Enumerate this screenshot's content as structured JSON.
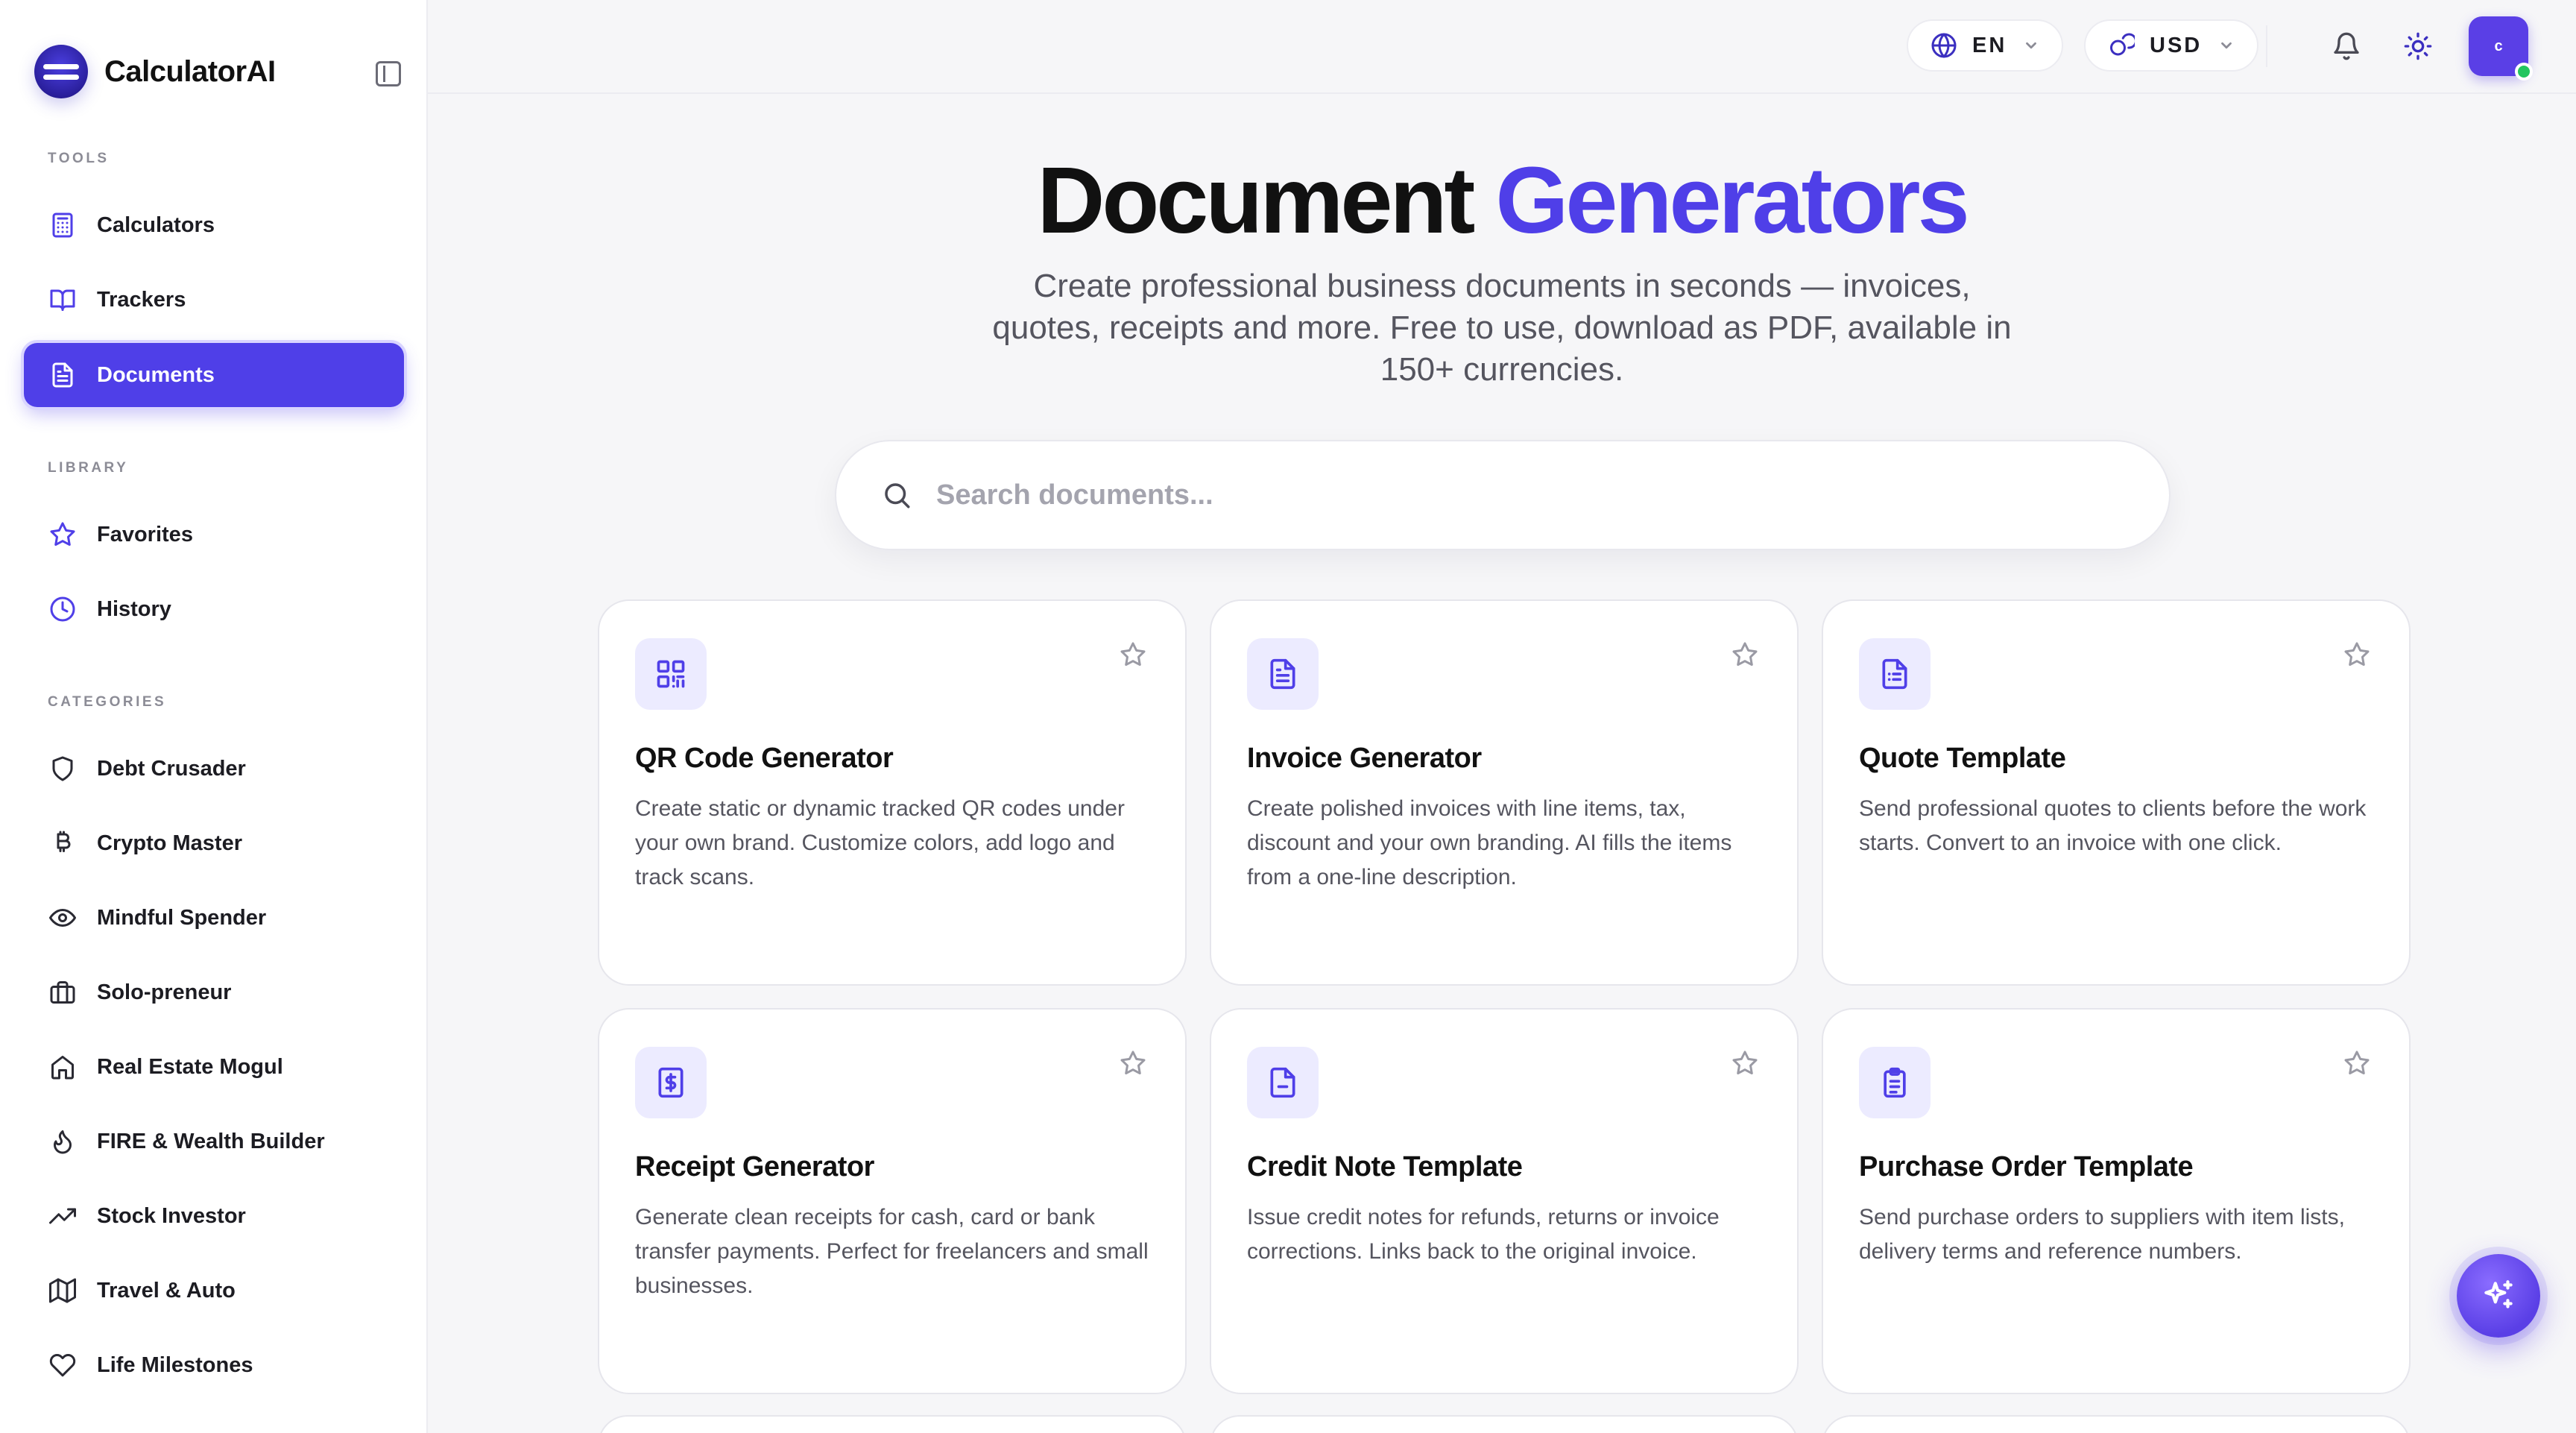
{
  "brand": {
    "name": "CalculatorAI"
  },
  "sidebar": {
    "tools_label": "TOOLS",
    "tools": [
      {
        "label": "Calculators",
        "icon": "calculator-icon"
      },
      {
        "label": "Trackers",
        "icon": "book-open-icon"
      },
      {
        "label": "Documents",
        "icon": "document-icon",
        "active": true
      }
    ],
    "library_label": "LIBRARY",
    "library": [
      {
        "label": "Favorites",
        "icon": "star-icon"
      },
      {
        "label": "History",
        "icon": "clock-icon"
      }
    ],
    "categories_label": "CATEGORIES",
    "categories": [
      {
        "label": "Debt Crusader",
        "icon": "shield-icon"
      },
      {
        "label": "Crypto Master",
        "icon": "bitcoin-icon"
      },
      {
        "label": "Mindful Spender",
        "icon": "eye-icon"
      },
      {
        "label": "Solo-preneur",
        "icon": "briefcase-icon"
      },
      {
        "label": "Real Estate Mogul",
        "icon": "home-icon"
      },
      {
        "label": "FIRE & Wealth Builder",
        "icon": "flame-icon"
      },
      {
        "label": "Stock Investor",
        "icon": "trending-up-icon"
      },
      {
        "label": "Travel & Auto",
        "icon": "map-icon"
      },
      {
        "label": "Life Milestones",
        "icon": "heart-icon"
      }
    ]
  },
  "topbar": {
    "language": "EN",
    "currency": "USD",
    "avatar_initial": "c"
  },
  "hero": {
    "title_main": "Document",
    "title_accent": "Generators",
    "subtitle": "Create professional business documents in seconds — invoices, quotes, receipts and more. Free to use, download as PDF, available in 150+ currencies."
  },
  "search": {
    "placeholder": "Search documents..."
  },
  "cards": [
    {
      "title": "QR Code Generator",
      "description": "Create static or dynamic tracked QR codes under your own brand. Customize colors, add logo and track scans.",
      "icon": "qr-code-icon"
    },
    {
      "title": "Invoice Generator",
      "description": "Create polished invoices with line items, tax, discount and your own branding. AI fills the items from a one-line description.",
      "icon": "invoice-icon"
    },
    {
      "title": "Quote Template",
      "description": "Send professional quotes to clients before the work starts. Convert to an invoice with one click.",
      "icon": "quote-icon"
    },
    {
      "title": "Receipt Generator",
      "description": "Generate clean receipts for cash, card or bank transfer payments. Perfect for freelancers and small businesses.",
      "icon": "receipt-icon"
    },
    {
      "title": "Credit Note Template",
      "description": "Issue credit notes for refunds, returns or invoice corrections. Links back to the original invoice.",
      "icon": "credit-note-icon"
    },
    {
      "title": "Purchase Order Template",
      "description": "Send purchase orders to suppliers with item lists, delivery terms and reference numbers.",
      "icon": "clipboard-icon"
    }
  ],
  "colors": {
    "accent": "#4f3fe8",
    "background": "#f6f6f8",
    "online": "#22c55e"
  }
}
